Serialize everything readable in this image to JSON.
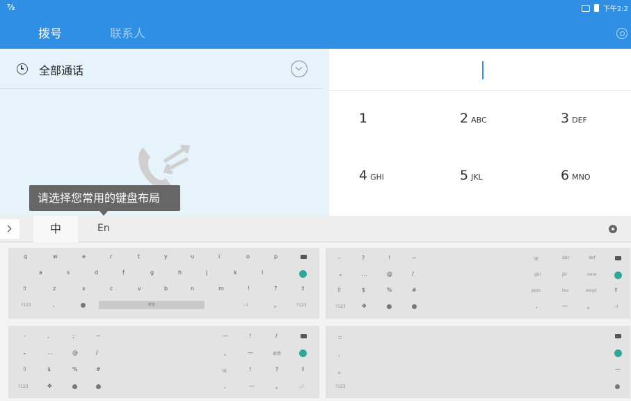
{
  "statusbar": {
    "left_icon": "notification-icon",
    "time": "下午2:2"
  },
  "appbar": {
    "tabs": [
      {
        "label": "拨号"
      },
      {
        "label": "联系人"
      }
    ],
    "settings_icon": "gear-icon"
  },
  "calls": {
    "title": "全部通话",
    "filter_icon": "chevron-down-icon",
    "history_icon": "clock-icon"
  },
  "tooltip": {
    "text": "请选择您常用的键盘布局"
  },
  "dialpad": {
    "keys": [
      {
        "num": "1",
        "letters": ""
      },
      {
        "num": "2",
        "letters": "ABC"
      },
      {
        "num": "3",
        "letters": "DEF"
      },
      {
        "num": "4",
        "letters": "GHI"
      },
      {
        "num": "5",
        "letters": "JKL"
      },
      {
        "num": "6",
        "letters": "MNO"
      }
    ]
  },
  "keyboard": {
    "tab_zh": "中",
    "tab_en": "En",
    "layout1": {
      "row1": [
        "q",
        "w",
        "e",
        "r",
        "t",
        "y",
        "u",
        "i",
        "o",
        "p"
      ],
      "row2": [
        "a",
        "s",
        "d",
        "f",
        "g",
        "h",
        "j",
        "k",
        "l"
      ],
      "row3": [
        "z",
        "x",
        "c",
        "v",
        "b",
        "n",
        "m",
        "!",
        "?"
      ],
      "row4": [
        "?123",
        ",",
        "。",
        "?123"
      ],
      "space_label": "拼音"
    },
    "layout2": {
      "row1": [
        "-",
        "?",
        "!",
        "~",
        "'词",
        "abc",
        "def"
      ],
      "row2": [
        "…",
        "@",
        "/",
        "ghi",
        "jkl",
        "mno"
      ],
      "row3": [
        "$",
        "%",
        "#",
        "pqrs",
        "tuv",
        "wxyz"
      ],
      "row4": [
        "?123",
        ",",
        "—",
        "。"
      ]
    },
    "layout3": {
      "row1": [
        "-",
        ",",
        ";",
        "~",
        "—",
        "!",
        "/"
      ],
      "row2": [
        "…",
        "@",
        "/",
        "、",
        "—",
        "表情"
      ],
      "row3": [
        "$",
        "%",
        "#",
        "'词",
        "!",
        "?"
      ],
      "row4": [
        "?123",
        ",",
        "—",
        "。"
      ]
    },
    "layout4": {
      "row1": [
        "::"
      ],
      "row2": [
        ","
      ],
      "row3": [
        "。"
      ],
      "row4": [
        "?123"
      ],
      "dash": "—"
    }
  }
}
